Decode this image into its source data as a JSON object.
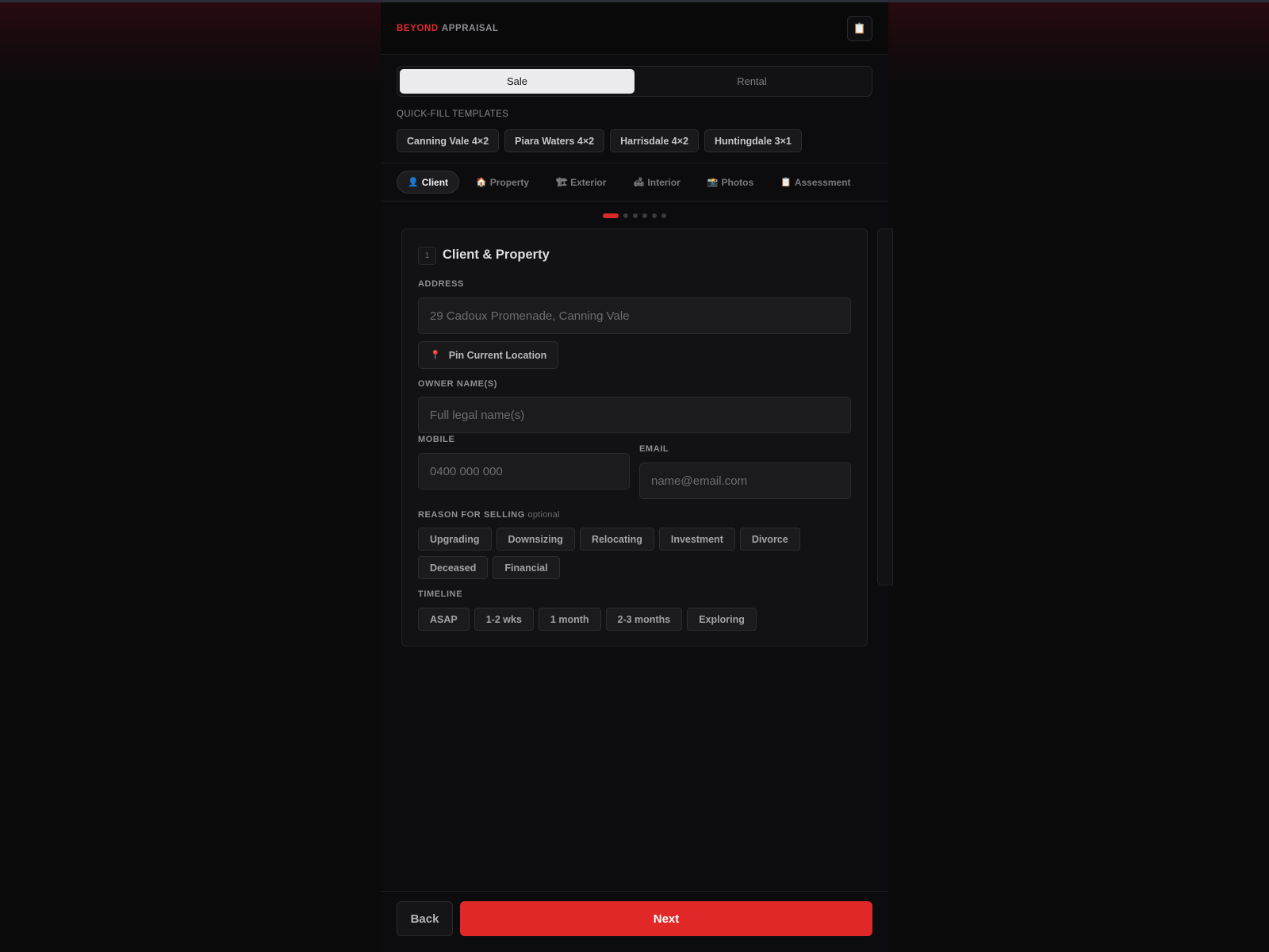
{
  "brand": {
    "part1": "BEYOND",
    "part2": "APPRAISAL"
  },
  "header": {
    "icon": "clipboard-icon",
    "icon_glyph": "📋"
  },
  "mode": {
    "options": [
      "Sale",
      "Rental"
    ],
    "selected": "Sale"
  },
  "quickfill": {
    "label": "QUICK-FILL TEMPLATES",
    "templates": [
      "Canning Vale 4×2",
      "Piara Waters 4×2",
      "Harrisdale 4×2",
      "Huntingdale 3×1"
    ]
  },
  "tabs": [
    {
      "icon": "👤",
      "label": "Client",
      "active": true
    },
    {
      "icon": "🏠",
      "label": "Property",
      "active": false
    },
    {
      "icon": "🏗",
      "label": "Exterior",
      "active": false
    },
    {
      "icon": "🛋",
      "label": "Interior",
      "active": false
    },
    {
      "icon": "📸",
      "label": "Photos",
      "active": false
    },
    {
      "icon": "📋",
      "label": "Assessment",
      "active": false
    }
  ],
  "progress": {
    "current_step": 1,
    "total_steps": 6
  },
  "card": {
    "step_number": "1",
    "title": "Client & Property",
    "address": {
      "label": "ADDRESS",
      "placeholder": "29 Cadoux Promenade, Canning Vale",
      "value": ""
    },
    "pin_button": {
      "icon": "📍",
      "label": "Pin Current Location"
    },
    "owner": {
      "label": "OWNER NAME(S)",
      "placeholder": "Full legal name(s)",
      "value": ""
    },
    "mobile": {
      "label": "MOBILE",
      "placeholder": "0400 000 000",
      "value": ""
    },
    "email": {
      "label": "EMAIL",
      "placeholder": "name@email.com",
      "value": ""
    },
    "reason": {
      "label": "REASON FOR SELLING",
      "optional": "optional",
      "options": [
        "Upgrading",
        "Downsizing",
        "Relocating",
        "Investment",
        "Divorce",
        "Deceased",
        "Financial"
      ]
    },
    "timeline": {
      "label": "TIMELINE",
      "options": [
        "ASAP",
        "1-2 wks",
        "1 month",
        "2-3 months",
        "Exploring"
      ]
    }
  },
  "footer": {
    "back_label": "Back",
    "next_label": "Next"
  },
  "colors": {
    "accent": "#e12828",
    "background": "#0b0b0c",
    "card": "#121214"
  }
}
